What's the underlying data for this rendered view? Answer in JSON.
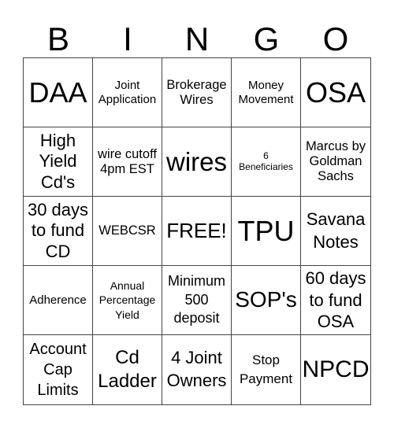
{
  "header": [
    "B",
    "I",
    "N",
    "G",
    "O"
  ],
  "cells": [
    "DAA",
    "Joint\nApplication",
    "Brokerage\nWires",
    "Money\nMovement",
    "OSA",
    "High\nYield\nCd's",
    "wire cutoff\n4pm EST",
    "wires",
    "6\nBeneficiaries",
    "Marcus by\nGoldman\nSachs",
    "30 days\nto fund\nCD",
    "WEBCSR",
    "FREE!",
    "TPU",
    "Savana\nNotes",
    "Adherence",
    "Annual\nPercentage\nYield",
    "Minimum\n500\ndeposit",
    "SOP's",
    "60 days\nto fund\nOSA",
    "Account\nCap\nLimits",
    "Cd\nLadder",
    "4 Joint\nOwners",
    "Stop\nPayment",
    "NPCD"
  ]
}
